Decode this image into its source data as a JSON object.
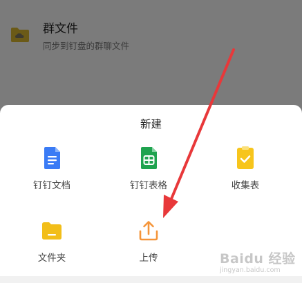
{
  "background": {
    "group_files": {
      "title": "群文件",
      "subtitle": "同步到钉盘的群聊文件",
      "icon": "folder-cloud-icon"
    }
  },
  "sheet": {
    "title": "新建",
    "items": [
      {
        "label": "钉钉文档",
        "icon": "doc-icon",
        "color": "#3a7bf5"
      },
      {
        "label": "钉钉表格",
        "icon": "sheet-icon",
        "color": "#1fa34f"
      },
      {
        "label": "收集表",
        "icon": "form-check-icon",
        "color": "#f7c51c"
      },
      {
        "label": "文件夹",
        "icon": "folder-icon",
        "color": "#f2be19"
      },
      {
        "label": "上传",
        "icon": "upload-icon",
        "color": "#f5953a"
      }
    ]
  },
  "annotation": {
    "arrow_color": "#e8383a"
  },
  "watermark": {
    "text": "Baidu 经验",
    "sub": "jingyan.baidu.com"
  }
}
